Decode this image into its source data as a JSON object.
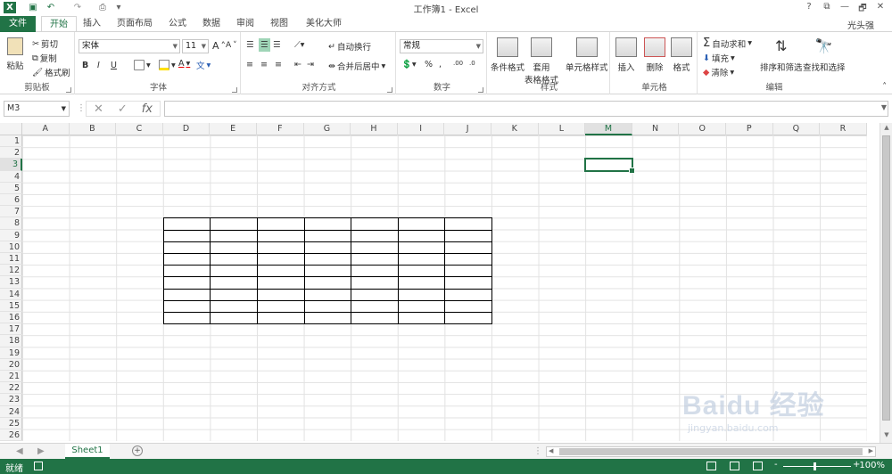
{
  "window": {
    "title": "工作簿1 - Excel",
    "user": "光头强",
    "help": "?",
    "minimize": "—",
    "restore": "🗗",
    "close": "✕"
  },
  "tabs": [
    {
      "label": "文件"
    },
    {
      "label": "开始"
    },
    {
      "label": "插入"
    },
    {
      "label": "页面布局"
    },
    {
      "label": "公式"
    },
    {
      "label": "数据"
    },
    {
      "label": "审阅"
    },
    {
      "label": "视图"
    },
    {
      "label": "美化大师"
    }
  ],
  "ribbon": {
    "clipboard": {
      "label": "剪贴板",
      "paste": "粘贴",
      "cut": "剪切",
      "copy": "复制",
      "format_painter": "格式刷"
    },
    "font": {
      "label": "字体",
      "name": "宋体",
      "size": "11",
      "bold": "B",
      "italic": "I",
      "underline": "U",
      "grow": "A",
      "shrink": "A",
      "color": "A",
      "phonetic": "文"
    },
    "align": {
      "label": "对齐方式",
      "wrap": "自动换行",
      "merge": "合并后居中"
    },
    "number": {
      "label": "数字",
      "format": "常规",
      "percent": "%",
      "comma": ","
    },
    "styles": {
      "label": "样式",
      "conditional": "条件格式",
      "table": "套用\n表格格式",
      "cell_styles": "单元格样式"
    },
    "cells": {
      "label": "单元格",
      "insert": "插入",
      "delete": "删除",
      "format": "格式"
    },
    "editing": {
      "label": "编辑",
      "autosum": "自动求和",
      "fill": "填充",
      "clear": "清除",
      "sort": "排序和筛选",
      "find": "查找和选择"
    }
  },
  "formula_bar": {
    "name_box": "M3",
    "fx": "fx",
    "cancel": "✕",
    "enter": "✓",
    "value": ""
  },
  "grid": {
    "columns": [
      "A",
      "B",
      "C",
      "D",
      "E",
      "F",
      "G",
      "H",
      "I",
      "J",
      "K",
      "L",
      "M",
      "N",
      "O",
      "P",
      "Q",
      "R"
    ],
    "rows": [
      "1",
      "2",
      "3",
      "4",
      "5",
      "6",
      "7",
      "8",
      "9",
      "10",
      "11",
      "12",
      "13",
      "14",
      "15",
      "16",
      "17",
      "18",
      "19",
      "20",
      "21",
      "22",
      "23",
      "24",
      "25",
      "26"
    ],
    "selected_cell": "M3",
    "selected_column": "M",
    "selected_row": "3"
  },
  "sheets": [
    {
      "label": "Sheet1"
    }
  ],
  "add_sheet": "+",
  "status": {
    "ready": "就绪",
    "zoom": "100%",
    "zoom_minus": "-",
    "zoom_plus": "+"
  },
  "watermark": {
    "brand": "Bai",
    "paw": "du",
    "cn": "经验",
    "url": "jingyan.baidu.com"
  }
}
